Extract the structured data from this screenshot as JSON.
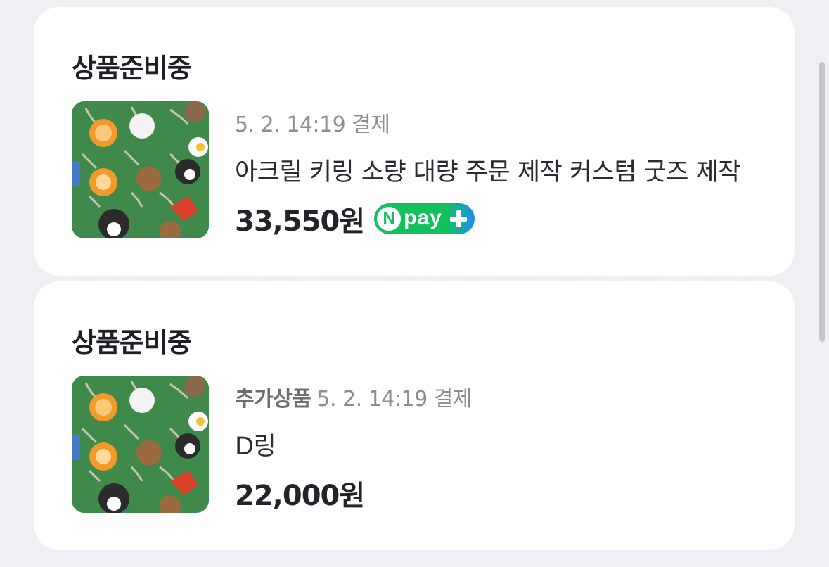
{
  "orders": [
    {
      "status": "상품준비중",
      "tag": "",
      "datetime": "5. 2. 14:19 결제",
      "name": "아크릴 키링 소량 대량 주문 제작 커스텀 굿즈 제작",
      "price": "33,550원",
      "npay": {
        "n": "N",
        "label": "pay"
      }
    },
    {
      "status": "상품준비중",
      "tag": "추가상품",
      "datetime": "5. 2. 14:19 결제",
      "name": "D링",
      "price": "22,000원"
    }
  ],
  "colors": {
    "npay_green": "#11c15b",
    "npay_blue": "#1e8ef2",
    "thumb_bg": "#3f8a4b"
  },
  "icons": {
    "thumbnail": "acrylic-keyring-product-photo",
    "npay": "npay-plus-badge"
  }
}
